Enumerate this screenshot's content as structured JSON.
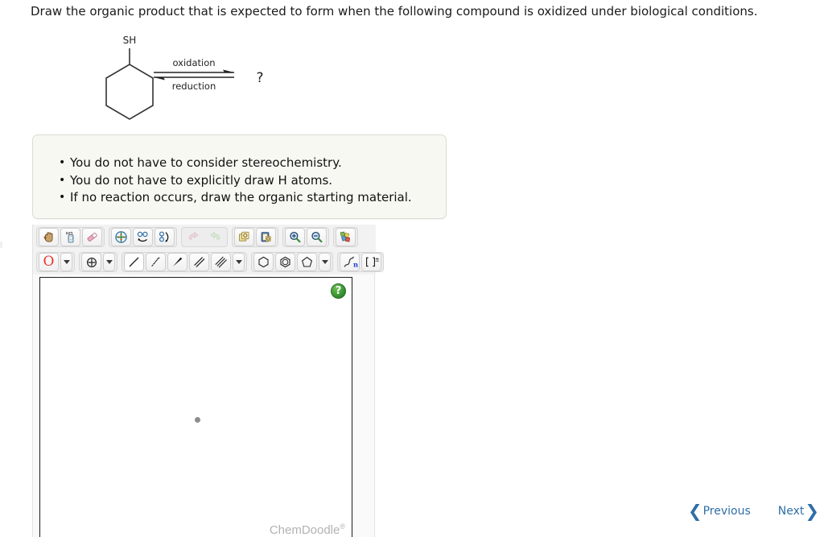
{
  "prompt": "Draw the organic product that is expected to form when the following compound is oxidized under biological conditions.",
  "scheme": {
    "reactant_label": "SH",
    "arrow_top_label": "oxidation",
    "arrow_bottom_label": "reduction",
    "product_label": "?"
  },
  "notes": {
    "items": [
      "You do not have to consider stereochemistry.",
      "You do not have to explicitly draw H atoms.",
      "If no reaction occurs, draw the organic starting material."
    ]
  },
  "sketcher": {
    "toolbar_row1": [
      {
        "name": "pan-hand-icon",
        "title": "Move / Pan",
        "enabled": true
      },
      {
        "name": "clear-spray-icon",
        "title": "Clear",
        "enabled": true
      },
      {
        "name": "eraser-icon",
        "title": "Erase",
        "enabled": true
      },
      {
        "name": "center-target-icon",
        "title": "Center Structure",
        "enabled": true
      },
      {
        "name": "flip-horizontal-icon",
        "title": "Flip Horizontal",
        "enabled": true
      },
      {
        "name": "flip-vertical-icon",
        "title": "Flip Vertical",
        "enabled": true
      },
      {
        "name": "undo-icon",
        "title": "Undo",
        "enabled": false
      },
      {
        "name": "redo-icon",
        "title": "Redo",
        "enabled": false
      },
      {
        "name": "copy-icon",
        "title": "Copy",
        "enabled": true
      },
      {
        "name": "paste-icon",
        "title": "Paste",
        "enabled": true
      },
      {
        "name": "zoom-in-icon",
        "title": "Zoom In",
        "enabled": true
      },
      {
        "name": "zoom-out-icon",
        "title": "Zoom Out",
        "enabled": true
      },
      {
        "name": "elements-palette-icon",
        "title": "Periodic Table",
        "enabled": true
      }
    ],
    "toolbar_row2": [
      {
        "name": "atom-label-oxygen-button",
        "label": "O",
        "color": "#e8352c"
      },
      {
        "name": "atom-label-dropdown",
        "label": "",
        "icon": "chevron-down-icon"
      },
      {
        "name": "charge-button",
        "label": "",
        "icon": "plus-circle-icon"
      },
      {
        "name": "charge-dropdown",
        "label": "",
        "icon": "chevron-down-icon"
      },
      {
        "name": "single-bond-tool",
        "label": "",
        "icon": "single-bond-icon",
        "selected": true
      },
      {
        "name": "hashed-wedge-bond-tool",
        "label": "",
        "icon": "hashed-wedge-bond-icon"
      },
      {
        "name": "solid-wedge-bond-tool",
        "label": "",
        "icon": "solid-wedge-bond-icon"
      },
      {
        "name": "double-bond-tool",
        "label": "",
        "icon": "double-bond-icon"
      },
      {
        "name": "triple-bond-tool",
        "label": "",
        "icon": "triple-bond-icon"
      },
      {
        "name": "bond-dropdown",
        "label": "",
        "icon": "chevron-down-icon"
      },
      {
        "name": "cyclohexane-ring-tool",
        "label": "",
        "icon": "hexagon-icon"
      },
      {
        "name": "benzene-ring-tool",
        "label": "",
        "icon": "benzene-icon"
      },
      {
        "name": "cyclopentane-ring-tool",
        "label": "",
        "icon": "pentagon-icon"
      },
      {
        "name": "ring-dropdown",
        "label": "",
        "icon": "chevron-down-icon"
      },
      {
        "name": "repeat-unit-tool",
        "label": "n",
        "icon": "polymer-n-icon"
      },
      {
        "name": "bracket-charge-tool",
        "label": "[ ]±",
        "icon": "bracket-charge-icon"
      }
    ],
    "canvas": {
      "help_label": "?",
      "watermark": "ChemDoodle",
      "watermark_mark": "®"
    }
  },
  "nav": {
    "previous_label": "Previous",
    "next_label": "Next",
    "prev_chevron": "❮",
    "next_chevron": "❯",
    "color": "#2f6fa8"
  }
}
